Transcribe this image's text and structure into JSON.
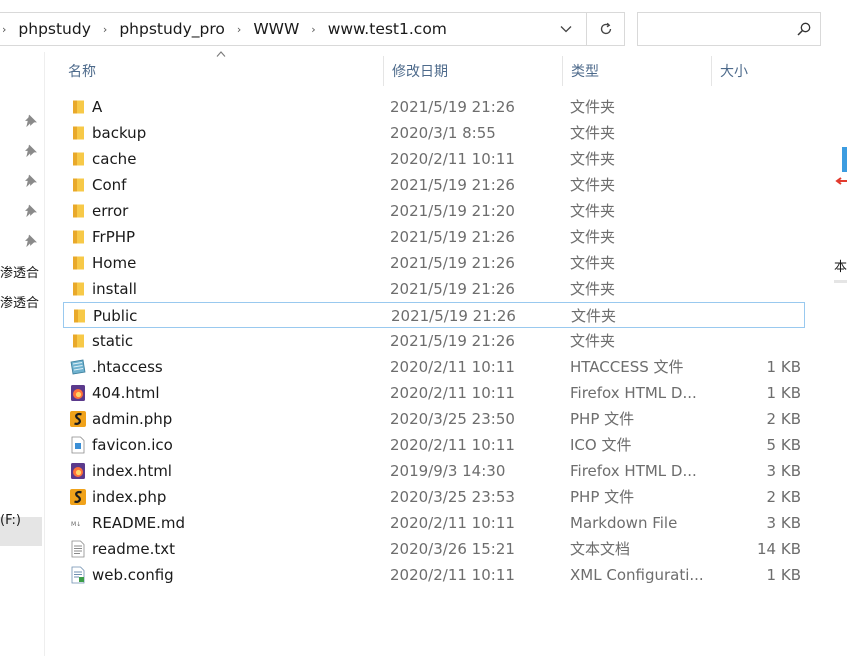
{
  "address": {
    "breadcrumbs": [
      "phpstudy",
      "phpstudy_pro",
      "WWW",
      "www.test1.com"
    ],
    "dropdown_icon": "chevron-down-icon",
    "refresh_icon": "refresh-icon"
  },
  "search": {
    "placeholder": "",
    "icon": "search-icon"
  },
  "navpane": {
    "items": [
      "渗透合",
      "渗透合",
      "(F:)"
    ]
  },
  "columns": {
    "name": "名称",
    "date": "修改日期",
    "type": "类型",
    "size": "大小"
  },
  "files": [
    {
      "name": "A",
      "date": "2021/5/19 21:26",
      "type": "文件夹",
      "size": "",
      "icon": "folder-icon"
    },
    {
      "name": "backup",
      "date": "2020/3/1 8:55",
      "type": "文件夹",
      "size": "",
      "icon": "folder-icon"
    },
    {
      "name": "cache",
      "date": "2020/2/11 10:11",
      "type": "文件夹",
      "size": "",
      "icon": "folder-icon"
    },
    {
      "name": "Conf",
      "date": "2021/5/19 21:26",
      "type": "文件夹",
      "size": "",
      "icon": "folder-icon"
    },
    {
      "name": "error",
      "date": "2021/5/19 21:20",
      "type": "文件夹",
      "size": "",
      "icon": "folder-icon"
    },
    {
      "name": "FrPHP",
      "date": "2021/5/19 21:26",
      "type": "文件夹",
      "size": "",
      "icon": "folder-icon"
    },
    {
      "name": "Home",
      "date": "2021/5/19 21:26",
      "type": "文件夹",
      "size": "",
      "icon": "folder-icon"
    },
    {
      "name": "install",
      "date": "2021/5/19 21:26",
      "type": "文件夹",
      "size": "",
      "icon": "folder-icon"
    },
    {
      "name": "Public",
      "date": "2021/5/19 21:26",
      "type": "文件夹",
      "size": "",
      "icon": "folder-icon",
      "selected": true
    },
    {
      "name": "static",
      "date": "2021/5/19 21:26",
      "type": "文件夹",
      "size": "",
      "icon": "folder-icon"
    },
    {
      "name": ".htaccess",
      "date": "2020/2/11 10:11",
      "type": "HTACCESS 文件",
      "size": "1 KB",
      "icon": "htaccess-file-icon"
    },
    {
      "name": "404.html",
      "date": "2020/2/11 10:11",
      "type": "Firefox HTML D...",
      "size": "1 KB",
      "icon": "firefox-html-icon"
    },
    {
      "name": "admin.php",
      "date": "2020/3/25 23:50",
      "type": "PHP 文件",
      "size": "2 KB",
      "icon": "php-file-icon"
    },
    {
      "name": "favicon.ico",
      "date": "2020/2/11 10:11",
      "type": "ICO 文件",
      "size": "5 KB",
      "icon": "ico-file-icon"
    },
    {
      "name": "index.html",
      "date": "2019/9/3 14:30",
      "type": "Firefox HTML D...",
      "size": "3 KB",
      "icon": "firefox-html-icon"
    },
    {
      "name": "index.php",
      "date": "2020/3/25 23:53",
      "type": "PHP 文件",
      "size": "2 KB",
      "icon": "php-file-icon"
    },
    {
      "name": "README.md",
      "date": "2020/2/11 10:11",
      "type": "Markdown File",
      "size": "3 KB",
      "icon": "markdown-file-icon"
    },
    {
      "name": "readme.txt",
      "date": "2020/3/26 15:21",
      "type": "文本文档",
      "size": "14 KB",
      "icon": "text-file-icon"
    },
    {
      "name": "web.config",
      "date": "2020/2/11 10:11",
      "type": "XML Configurati...",
      "size": "1 KB",
      "icon": "config-file-icon"
    }
  ],
  "edge": {
    "text": "本"
  },
  "colors": {
    "header_text": "#4d6a8b",
    "selection_border": "#99c9ef",
    "folder": "#f5c342",
    "secondary_text": "#6d6d6d"
  }
}
